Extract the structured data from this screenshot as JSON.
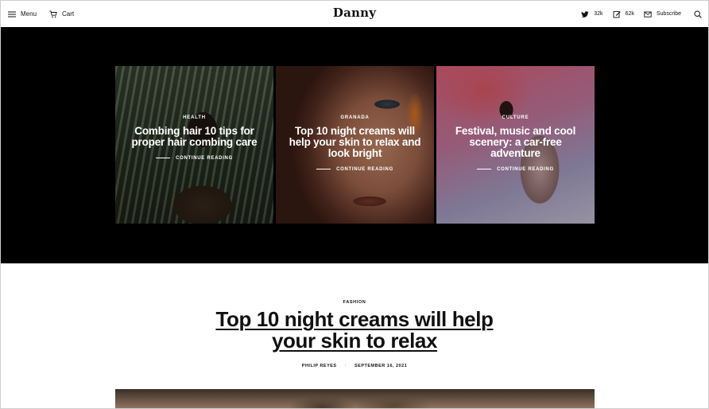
{
  "header": {
    "menu_label": "Menu",
    "cart_label": "Cart",
    "logo": "Danny",
    "twitter_count": "32k",
    "edit_count": "62k",
    "subscribe_label": "Subscribe",
    "icons": [
      "hamburger-icon",
      "cart-icon",
      "twitter-icon",
      "edit-icon",
      "mail-icon",
      "search-icon"
    ]
  },
  "featured": [
    {
      "category": "HEALTH",
      "title": "Combing hair 10 tips for proper hair combing care",
      "cta": "CONTINUE READING"
    },
    {
      "category": "GRANADA",
      "title": "Top 10 night creams will help your skin to relax and look bright",
      "cta": "CONTINUE READING"
    },
    {
      "category": "CULTURE",
      "title": "Festival, music and cool scenery: a car-free adventure",
      "cta": "CONTINUE READING"
    }
  ],
  "article": {
    "category": "FASHION",
    "title_line1": "Top 10 night creams will help",
    "title_line2": "your skin to relax",
    "author": "PHILIP REYES",
    "date": "SEPTEMBER 16, 2021"
  },
  "colors": {
    "hero_bg": "#000000",
    "text": "#111111",
    "background": "#ffffff"
  }
}
